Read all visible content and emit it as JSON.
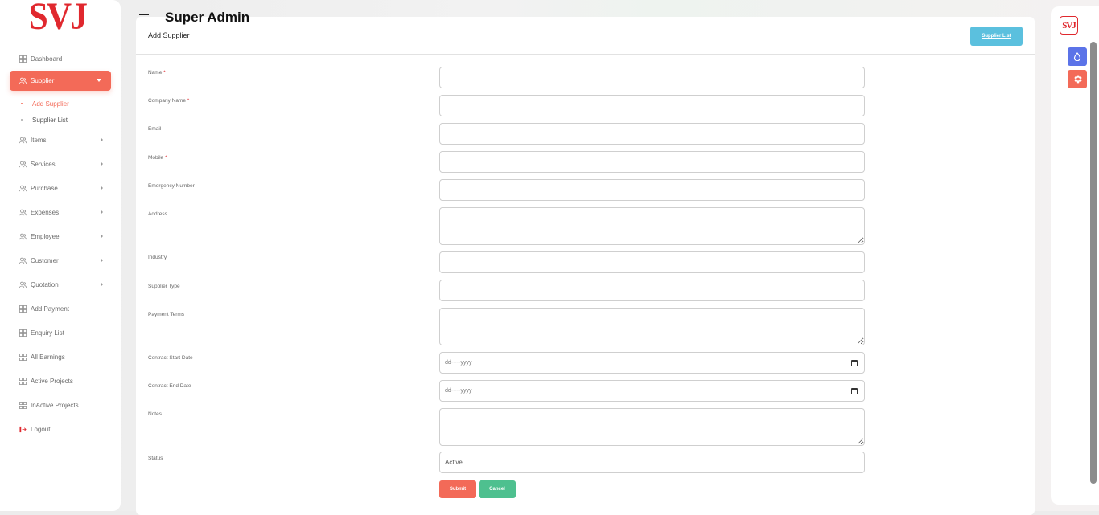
{
  "sidebar": {
    "logo_text": "SVJ",
    "items": [
      {
        "label": "Dashboard",
        "icon": "grid-icon"
      },
      {
        "label": "Supplier",
        "icon": "users-icon",
        "active": true,
        "sub": [
          {
            "label": "Add Supplier",
            "active": true
          },
          {
            "label": "Supplier List"
          }
        ]
      },
      {
        "label": "Items",
        "icon": "users-icon"
      },
      {
        "label": "Services",
        "icon": "users-icon"
      },
      {
        "label": "Purchase",
        "icon": "users-icon"
      },
      {
        "label": "Expenses",
        "icon": "users-icon"
      },
      {
        "label": "Employee",
        "icon": "users-icon"
      },
      {
        "label": "Customer",
        "icon": "users-icon"
      },
      {
        "label": "Quotation",
        "icon": "users-icon"
      },
      {
        "label": "Add Payment",
        "icon": "grid-icon"
      },
      {
        "label": "Enquiry List",
        "icon": "grid-icon"
      },
      {
        "label": "All Earnings",
        "icon": "grid-icon"
      },
      {
        "label": "Active Projects",
        "icon": "grid-icon"
      },
      {
        "label": "InActive Projects",
        "icon": "grid-icon"
      },
      {
        "label": "Logout",
        "icon": "logout-icon"
      }
    ]
  },
  "header": {
    "title": "Super Admin"
  },
  "card": {
    "title": "Add Supplier",
    "list_button": "Supplier List"
  },
  "form": {
    "name": {
      "label": "Name",
      "required": "*",
      "value": ""
    },
    "company": {
      "label": "Company Name",
      "required": "*",
      "value": ""
    },
    "email": {
      "label": "Email",
      "value": ""
    },
    "mobile": {
      "label": "Mobile",
      "required": "*",
      "value": ""
    },
    "emergency": {
      "label": "Emergency Number",
      "value": ""
    },
    "address": {
      "label": "Address",
      "value": ""
    },
    "industry": {
      "label": "Industry",
      "value": ""
    },
    "supplier_type": {
      "label": "Supplier Type",
      "value": ""
    },
    "payment_terms": {
      "label": "Payment Terms",
      "value": ""
    },
    "contract_start": {
      "label": "Contract Start Date",
      "placeholder": "dd-----yyyy"
    },
    "contract_end": {
      "label": "Contract End Date",
      "placeholder": "dd-----yyyy"
    },
    "notes": {
      "label": "Notes",
      "value": ""
    },
    "status": {
      "label": "Status",
      "value": "Active"
    },
    "submit_label": "Submit",
    "cancel_label": "Cancel"
  },
  "right_bar": {
    "logo_text": "SVJ"
  },
  "colors": {
    "accent": "#f36a58",
    "info": "#5bc0de",
    "success": "#4ec08f",
    "primary": "#5b73e8",
    "brand_red": "#e0282e"
  }
}
